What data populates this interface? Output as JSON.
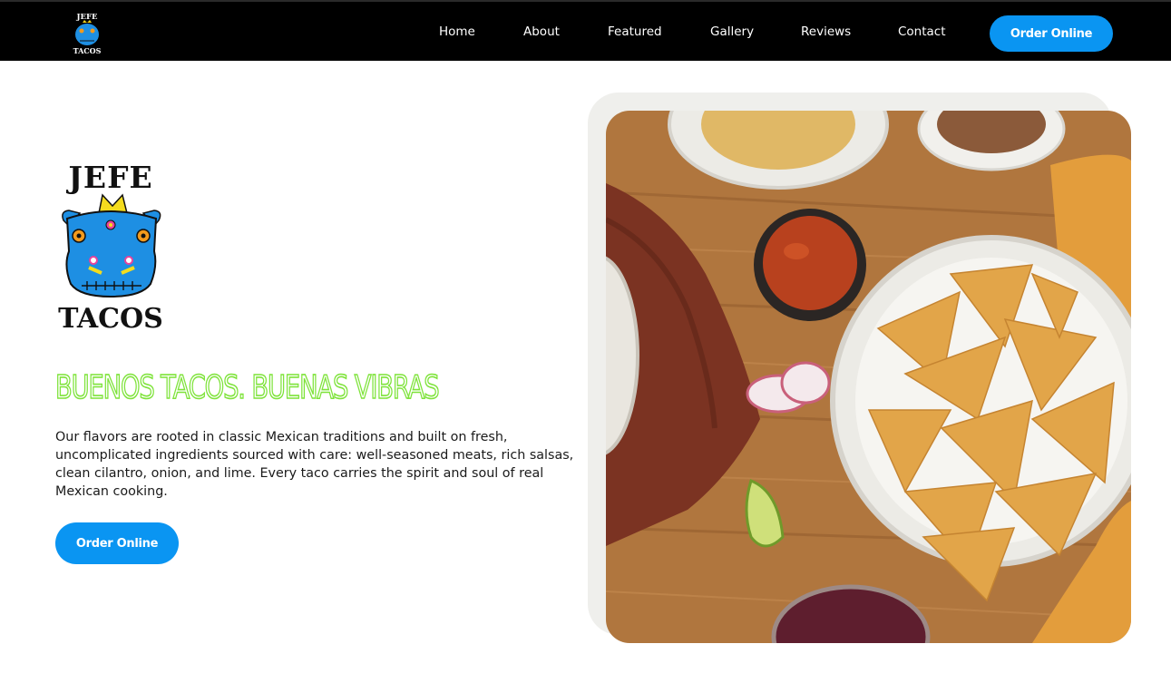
{
  "brand": {
    "logo_top": "JEFE",
    "logo_bottom": "TACOS",
    "colors": {
      "accent": "#0a95f2",
      "headline": "#7ee33a",
      "nav_bg": "#000000"
    }
  },
  "nav": {
    "items": [
      {
        "label": "Home"
      },
      {
        "label": "About"
      },
      {
        "label": "Featured"
      },
      {
        "label": "Gallery"
      },
      {
        "label": "Reviews"
      },
      {
        "label": "Contact"
      }
    ],
    "cta_label": "Order Online"
  },
  "hero": {
    "headline": "BUENOS TACOS. BUENAS VIBRAS",
    "description": "Our flavors are rooted in classic Mexican traditions and built on fresh, uncomplicated ingredients sourced with care: well-seasoned meats, rich salsas, clean cilantro, onion, and lime. Every taco carries the spirit and soul of real Mexican cooking.",
    "cta_label": "Order Online"
  }
}
